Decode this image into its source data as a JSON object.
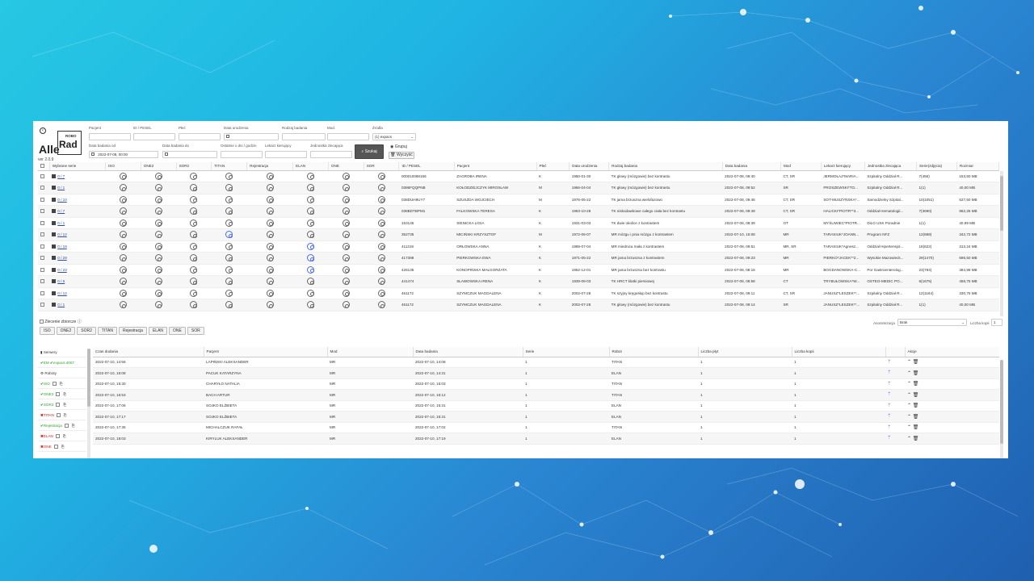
{
  "app": {
    "brand_alle": "Alle",
    "brand_robo": "ROBO",
    "brand_rad": "Rad",
    "version": "ver 2.0.9"
  },
  "filters": {
    "patient_label": "Pacjent",
    "id_label": "ID / PESEL",
    "sex_label": "Płeć",
    "birth_label": "Data urodzenia",
    "exam_type_label": "Rodzaj badania",
    "mod_label": "Mod.",
    "source_label": "Źródła",
    "source_value": "(1) expacs",
    "date_from_label": "Data badania od",
    "date_from_value": "2022-07-08, 00:00",
    "date_to_label": "Data badania do",
    "last_days_label": "Ostatnie x dni / godzin",
    "doctor_label": "Lekarz kierujący",
    "unit_label": "Jednostka zlecająca",
    "search_button": "Szukaj",
    "group_label": "Grupuj",
    "clear_button": "Wyczyść"
  },
  "main_table": {
    "headers": [
      "Wybrane serie",
      "ISO",
      "ONE2",
      "SOR2",
      "TITAN",
      "Rejestracja",
      "ELAN",
      "ONE",
      "SOR",
      "ID / PESEL",
      "Pacjent",
      "Płeć",
      "Data urodzenia",
      "Rodzaj badania",
      "Data badania",
      "Mod",
      "Lekarz kierujący",
      "Jednostka zlecająca",
      "Serie(zdjęcia)",
      "Rozmiar"
    ],
    "rows": [
      {
        "series": "0 / 7",
        "id": "000010088166",
        "patient": "ZAGROBA IRENA",
        "sex": "K",
        "birth": "1950-01-30",
        "exam": "TK głowy (mózgowie) bez kontrastu",
        "date": "2022-07-08, 09:40",
        "mod": "CT, SR",
        "doctor": "JERMOŁAJ*MARIA...",
        "unit": "Szpitalny Oddział R...",
        "count": "7(456)",
        "size": "153,50 MB",
        "blue": []
      },
      {
        "series": "0 / 1",
        "id": "0386FQQPNB",
        "patient": "KOŁODZIEJCZYK MIROSŁAW",
        "sex": "M",
        "birth": "1966-04-04",
        "exam": "TK głowy (mózgowie) bez kontrastu",
        "date": "2022-07-08, 09:52",
        "mod": "SR",
        "doctor": "PROSZEWSKI*TO...",
        "unit": "Szpitalny Oddział R...",
        "count": "1(1)",
        "size": "40,00 MB",
        "blue": []
      },
      {
        "series": "0 / 10",
        "id": "038DUH9UY7",
        "patient": "SZUSZDA WOJCIECH",
        "sex": "M",
        "birth": "1976-05-22",
        "exam": "TK jama brzuszna wielofazowo",
        "date": "2022-07-08, 09:45",
        "mod": "CT, SR",
        "doctor": "SOT-MUSZYŃSKA*...",
        "unit": "Samodzielny Szpital...",
        "count": "10(1051)",
        "size": "527,50 MB",
        "blue": []
      },
      {
        "series": "0 / 7",
        "id": "038BDTBPM1",
        "patient": "FALKOWSKA TERESA",
        "sex": "K",
        "birth": "1963-10-28",
        "exam": "TK niskodawkowe całego ciała bez kontrastu",
        "date": "2022-07-08, 09:49",
        "mod": "CT, SR",
        "doctor": "HALICKI*PIOTR**3...",
        "unit": "Oddział Hematologii...",
        "count": "7(3690)",
        "size": "962,25 MB",
        "blue": []
      },
      {
        "series": "0 / 1",
        "id": "153145",
        "patient": "SIENICKA LIGIA",
        "sex": "K",
        "birth": "1931-03-03",
        "exam": "TK dwie okolice z kontrastem",
        "date": "2022-07-08, 08:39",
        "mod": "OT",
        "doctor": "MYŚLIWIEC*PIOTR...",
        "unit": "DiLO USK Poradnie",
        "count": "1(1)",
        "size": "40,99 MB",
        "blue": []
      },
      {
        "series": "0 / 12",
        "id": "352735",
        "patient": "MICIŃSKI KRZYSZTOF",
        "sex": "M",
        "birth": "1972-06-07",
        "exam": "MR mózgu i pnia mózgu z kontrastem",
        "date": "2022-07-10, 15:08",
        "mod": "MR",
        "doctor": "TARASIUK*JOANN...",
        "unit": "Program NFZ",
        "count": "12(688)",
        "size": "342,72 MB",
        "blue": [
          3
        ]
      },
      {
        "series": "0 / 18",
        "id": "411319",
        "patient": "ORŁOWSKA ANNA",
        "sex": "K",
        "birth": "1989-07-04",
        "exam": "MR miednica mała z kontrastem",
        "date": "2022-07-08, 09:51",
        "mod": "MR, SR",
        "doctor": "TARASIUK*Agnesz...",
        "unit": "Oddział Hipertensjol...",
        "count": "18(622)",
        "size": "313,24 MB",
        "blue": [
          5
        ]
      },
      {
        "series": "0 / 29",
        "id": "417388",
        "patient": "PIERKOWSKA EWA",
        "sex": "K",
        "birth": "1971-05-22",
        "exam": "MR jama brzuszna z kontrastem",
        "date": "2022-07-08, 09:23",
        "mod": "MR",
        "doctor": "PIERKO*JACEK**2...",
        "unit": "Wysokie Mazowieck...",
        "count": "29(1470)",
        "size": "686,50 MB",
        "blue": [
          5
        ]
      },
      {
        "series": "0 / 23",
        "id": "426135",
        "patient": "KONOPIŃSKA MAŁGORZATA",
        "sex": "K",
        "birth": "1952-12-01",
        "exam": "MR jama brzuszna bez kontrastu",
        "date": "2022-07-08, 08:16",
        "mod": "MR",
        "doctor": "BOGDANOWSKA-C...",
        "unit": "Por Gastroenterolog...",
        "count": "23(784)",
        "size": "384,98 MB",
        "blue": [
          5
        ]
      },
      {
        "series": "0 / 6",
        "id": "441474",
        "patient": "SŁAWOWSKA IRENA",
        "sex": "K",
        "birth": "1939-08-03",
        "exam": "TK HRCT klatki piersiowej",
        "date": "2022-07-08, 08:58",
        "mod": "CT",
        "doctor": "TRYBUŁOWSKA*W...",
        "unit": "OSTEO-MEDIC PO...",
        "count": "6(1675)",
        "size": "458,75 MB",
        "blue": []
      },
      {
        "series": "0 / 12",
        "id": "461172",
        "patient": "SZYMCZUK MAGDALENA",
        "sex": "K",
        "birth": "2002-07-28",
        "exam": "TK szyjny kręgosłup bez kontrastu",
        "date": "2022-07-08, 09:11",
        "mod": "CT, SR",
        "doctor": "JANUSZ*LESZEK**...",
        "unit": "Szpitalny Oddział R...",
        "count": "12(1164)",
        "size": "330,75 MB",
        "blue": []
      },
      {
        "series": "0 / 1",
        "id": "461172",
        "patient": "SZYMCZUK MAGDALENA",
        "sex": "K",
        "birth": "2002-07-28",
        "exam": "TK głowy (mózgowie) bez kontrastu",
        "date": "2022-07-08, 09:14",
        "mod": "SR",
        "doctor": "JANUSZ*LESZEK**...",
        "unit": "Szpitalny Oddział R...",
        "count": "1(1)",
        "size": "40,00 MB",
        "blue": []
      }
    ]
  },
  "toolbar": {
    "bulk_label": "Zlecenie zbiorcze",
    "robots": [
      "ISO",
      "ONE2",
      "SOR2",
      "TITAN",
      "Rejestracja",
      "ELAN",
      "ONE",
      "SOR"
    ],
    "anonymization_label": "Anonimizacja",
    "anonymization_value": "Brak",
    "copies_label": "Liczba kopii",
    "copies_value": "1"
  },
  "side": {
    "servers_label": "Serwery",
    "server_items": [
      "EM",
      "expacs:4007"
    ],
    "robots_label": "Roboty",
    "robots": [
      {
        "name": "ISO",
        "ok": true
      },
      {
        "name": "ONE2",
        "ok": true
      },
      {
        "name": "SOR2",
        "ok": true
      },
      {
        "name": "TITAN",
        "ok": false
      },
      {
        "name": "Rejestracja",
        "ok": true
      },
      {
        "name": "ELAN",
        "ok": false
      },
      {
        "name": "ONE",
        "ok": false
      }
    ]
  },
  "bottom_table": {
    "headers": [
      "Czas dodania",
      "Pacjent",
      "Mod",
      "Data badania",
      "Serie",
      "Robot",
      "Liczba płyt",
      "Liczba kopii",
      "",
      "Akcje"
    ],
    "rows": [
      {
        "added": "2022-07-10, 14:56",
        "patient": "LAPIŃSKI ALEKSANDER",
        "mod": "MR",
        "date": "2022-07-10, 14:08",
        "series": "1",
        "robot": "TITAN",
        "discs": "1",
        "copies": "1"
      },
      {
        "added": "2022-07-10, 15:08",
        "patient": "PACUK KATARZYNA",
        "mod": "MR",
        "date": "2022-07-10, 14:31",
        "series": "1",
        "robot": "ELAN",
        "discs": "1",
        "copies": "1"
      },
      {
        "added": "2022-07-10, 15:30",
        "patient": "CHARYŁO NATALIA",
        "mod": "MR",
        "date": "2022-07-10, 15:03",
        "series": "1",
        "robot": "TITAN",
        "discs": "1",
        "copies": "1"
      },
      {
        "added": "2022-07-10, 16:53",
        "patient": "BACH ARTUR",
        "mod": "MR",
        "date": "2022-07-10, 16:12",
        "series": "1",
        "robot": "TITAN",
        "discs": "1",
        "copies": "1"
      },
      {
        "added": "2022-07-10, 17:06",
        "patient": "SOJKO ELŻBIETA",
        "mod": "MR",
        "date": "2022-07-10, 15:31",
        "series": "1",
        "robot": "ELAN",
        "discs": "1",
        "copies": "1"
      },
      {
        "added": "2022-07-10, 17:17",
        "patient": "SOJKO ELŻBIETA",
        "mod": "MR",
        "date": "2022-07-10, 15:31",
        "series": "1",
        "robot": "ELAN",
        "discs": "1",
        "copies": "1"
      },
      {
        "added": "2022-07-10, 17:35",
        "patient": "MICHALCZUK RAFAŁ",
        "mod": "MR",
        "date": "2022-07-10, 17:02",
        "series": "1",
        "robot": "TITAN",
        "discs": "1",
        "copies": "1"
      },
      {
        "added": "2022-07-10, 18:03",
        "patient": "KIRYLUK ALEKSANDER",
        "mod": "MR",
        "date": "2022-07-10, 17:19",
        "series": "1",
        "robot": "ELAN",
        "discs": "1",
        "copies": "1"
      }
    ]
  },
  "colors": {
    "accent": "#2d4ea6",
    "ok": "#2aa52a",
    "error": "#d02020",
    "antenna": "#7a5ce0"
  }
}
